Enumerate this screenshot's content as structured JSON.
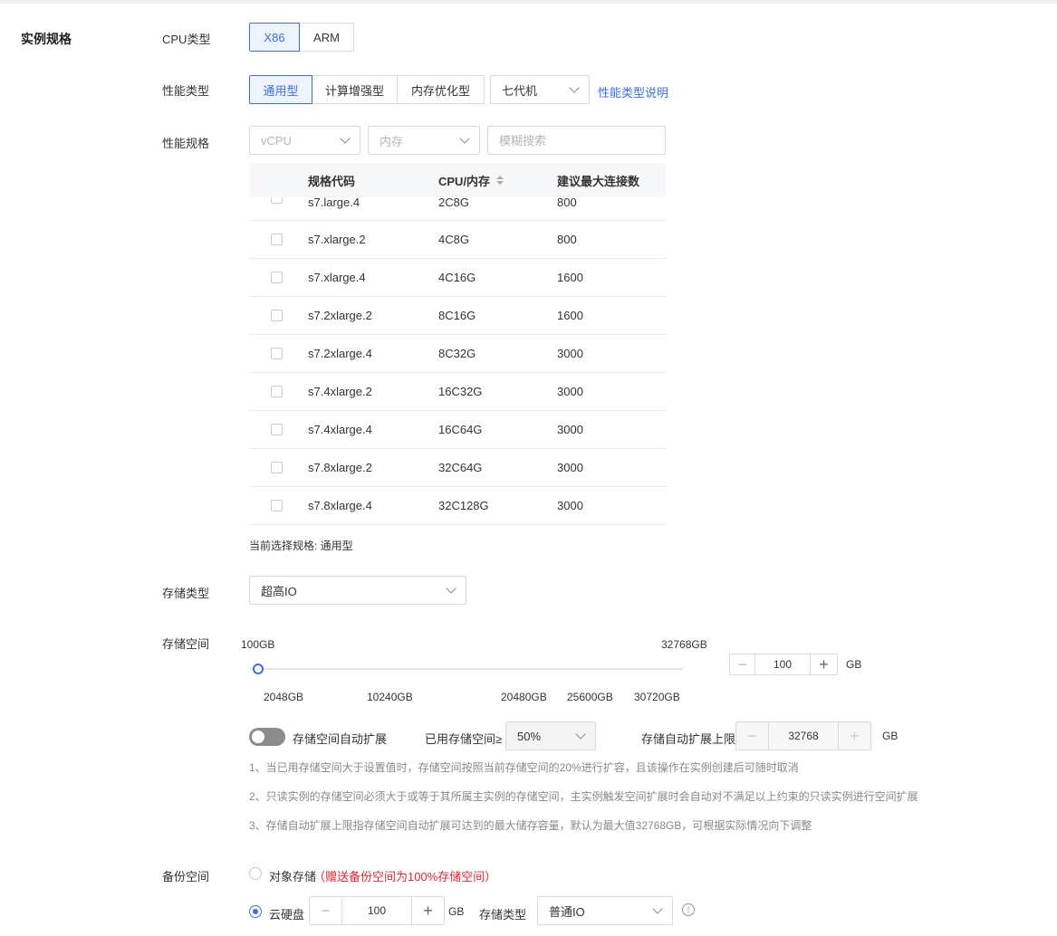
{
  "section_title": "实例规格",
  "cpu_type": {
    "label": "CPU类型",
    "options": [
      "X86",
      "ARM"
    ],
    "selected": "X86"
  },
  "perf_type": {
    "label": "性能类型",
    "options": [
      "通用型",
      "计算增强型",
      "内存优化型"
    ],
    "selected": "通用型",
    "generation": "七代机",
    "help_link": "性能类型说明"
  },
  "perf_spec": {
    "label": "性能规格",
    "vcpu_placeholder": "vCPU",
    "memory_placeholder": "内存",
    "search_placeholder": "模糊搜索"
  },
  "spec_table": {
    "headers": [
      "规格代码",
      "CPU/内存",
      "建议最大连接数"
    ],
    "rows": [
      {
        "code": "s7.large.4",
        "cpu_mem": "2C8G",
        "conn": "800"
      },
      {
        "code": "s7.xlarge.2",
        "cpu_mem": "4C8G",
        "conn": "800"
      },
      {
        "code": "s7.xlarge.4",
        "cpu_mem": "4C16G",
        "conn": "1600"
      },
      {
        "code": "s7.2xlarge.2",
        "cpu_mem": "8C16G",
        "conn": "1600"
      },
      {
        "code": "s7.2xlarge.4",
        "cpu_mem": "8C32G",
        "conn": "3000"
      },
      {
        "code": "s7.4xlarge.2",
        "cpu_mem": "16C32G",
        "conn": "3000"
      },
      {
        "code": "s7.4xlarge.4",
        "cpu_mem": "16C64G",
        "conn": "3000"
      },
      {
        "code": "s7.8xlarge.2",
        "cpu_mem": "32C64G",
        "conn": "3000"
      },
      {
        "code": "s7.8xlarge.4",
        "cpu_mem": "32C128G",
        "conn": "3000"
      }
    ]
  },
  "current_selection": "当前选择规格: 通用型",
  "storage_type": {
    "label": "存储类型",
    "value": "超高IO"
  },
  "storage_space": {
    "label": "存储空间",
    "min": "100GB",
    "max": "32768GB",
    "marks": [
      "2048GB",
      "10240GB",
      "20480GB",
      "25600GB",
      "30720GB"
    ],
    "value": "100",
    "unit": "GB"
  },
  "auto_expand": {
    "label": "存储空间自动扩展",
    "enabled": false,
    "threshold_label": "已用存储空间≥",
    "threshold_value": "50%",
    "limit_label": "存储自动扩展上限",
    "limit_value": "32768",
    "unit": "GB"
  },
  "tips": [
    "1、当已用存储空间大于设置值时，存储空间按照当前存储空间的20%进行扩容，且该操作在实例创建后可随时取消",
    "2、只读实例的存储空间必须大于或等于其所属主实例的存储空间，主实例触发空间扩展时会自动对不满足以上约束的只读实例进行空间扩展",
    "3、存储自动扩展上限指存储空间自动扩展可达到的最大储存容量，默认为最大值32768GB，可根据实际情况向下调整"
  ],
  "backup": {
    "label": "备份空间",
    "object_storage": "对象存储",
    "object_storage_note": "（赠送备份空间为100%存储空间）",
    "cloud_disk": "云硬盘",
    "cloud_disk_value": "100",
    "unit": "GB",
    "storage_type_label": "存储类型",
    "storage_type_value": "普通IO"
  },
  "colors": {
    "accent": "#3a6ee8",
    "warning": "#e6252e"
  }
}
